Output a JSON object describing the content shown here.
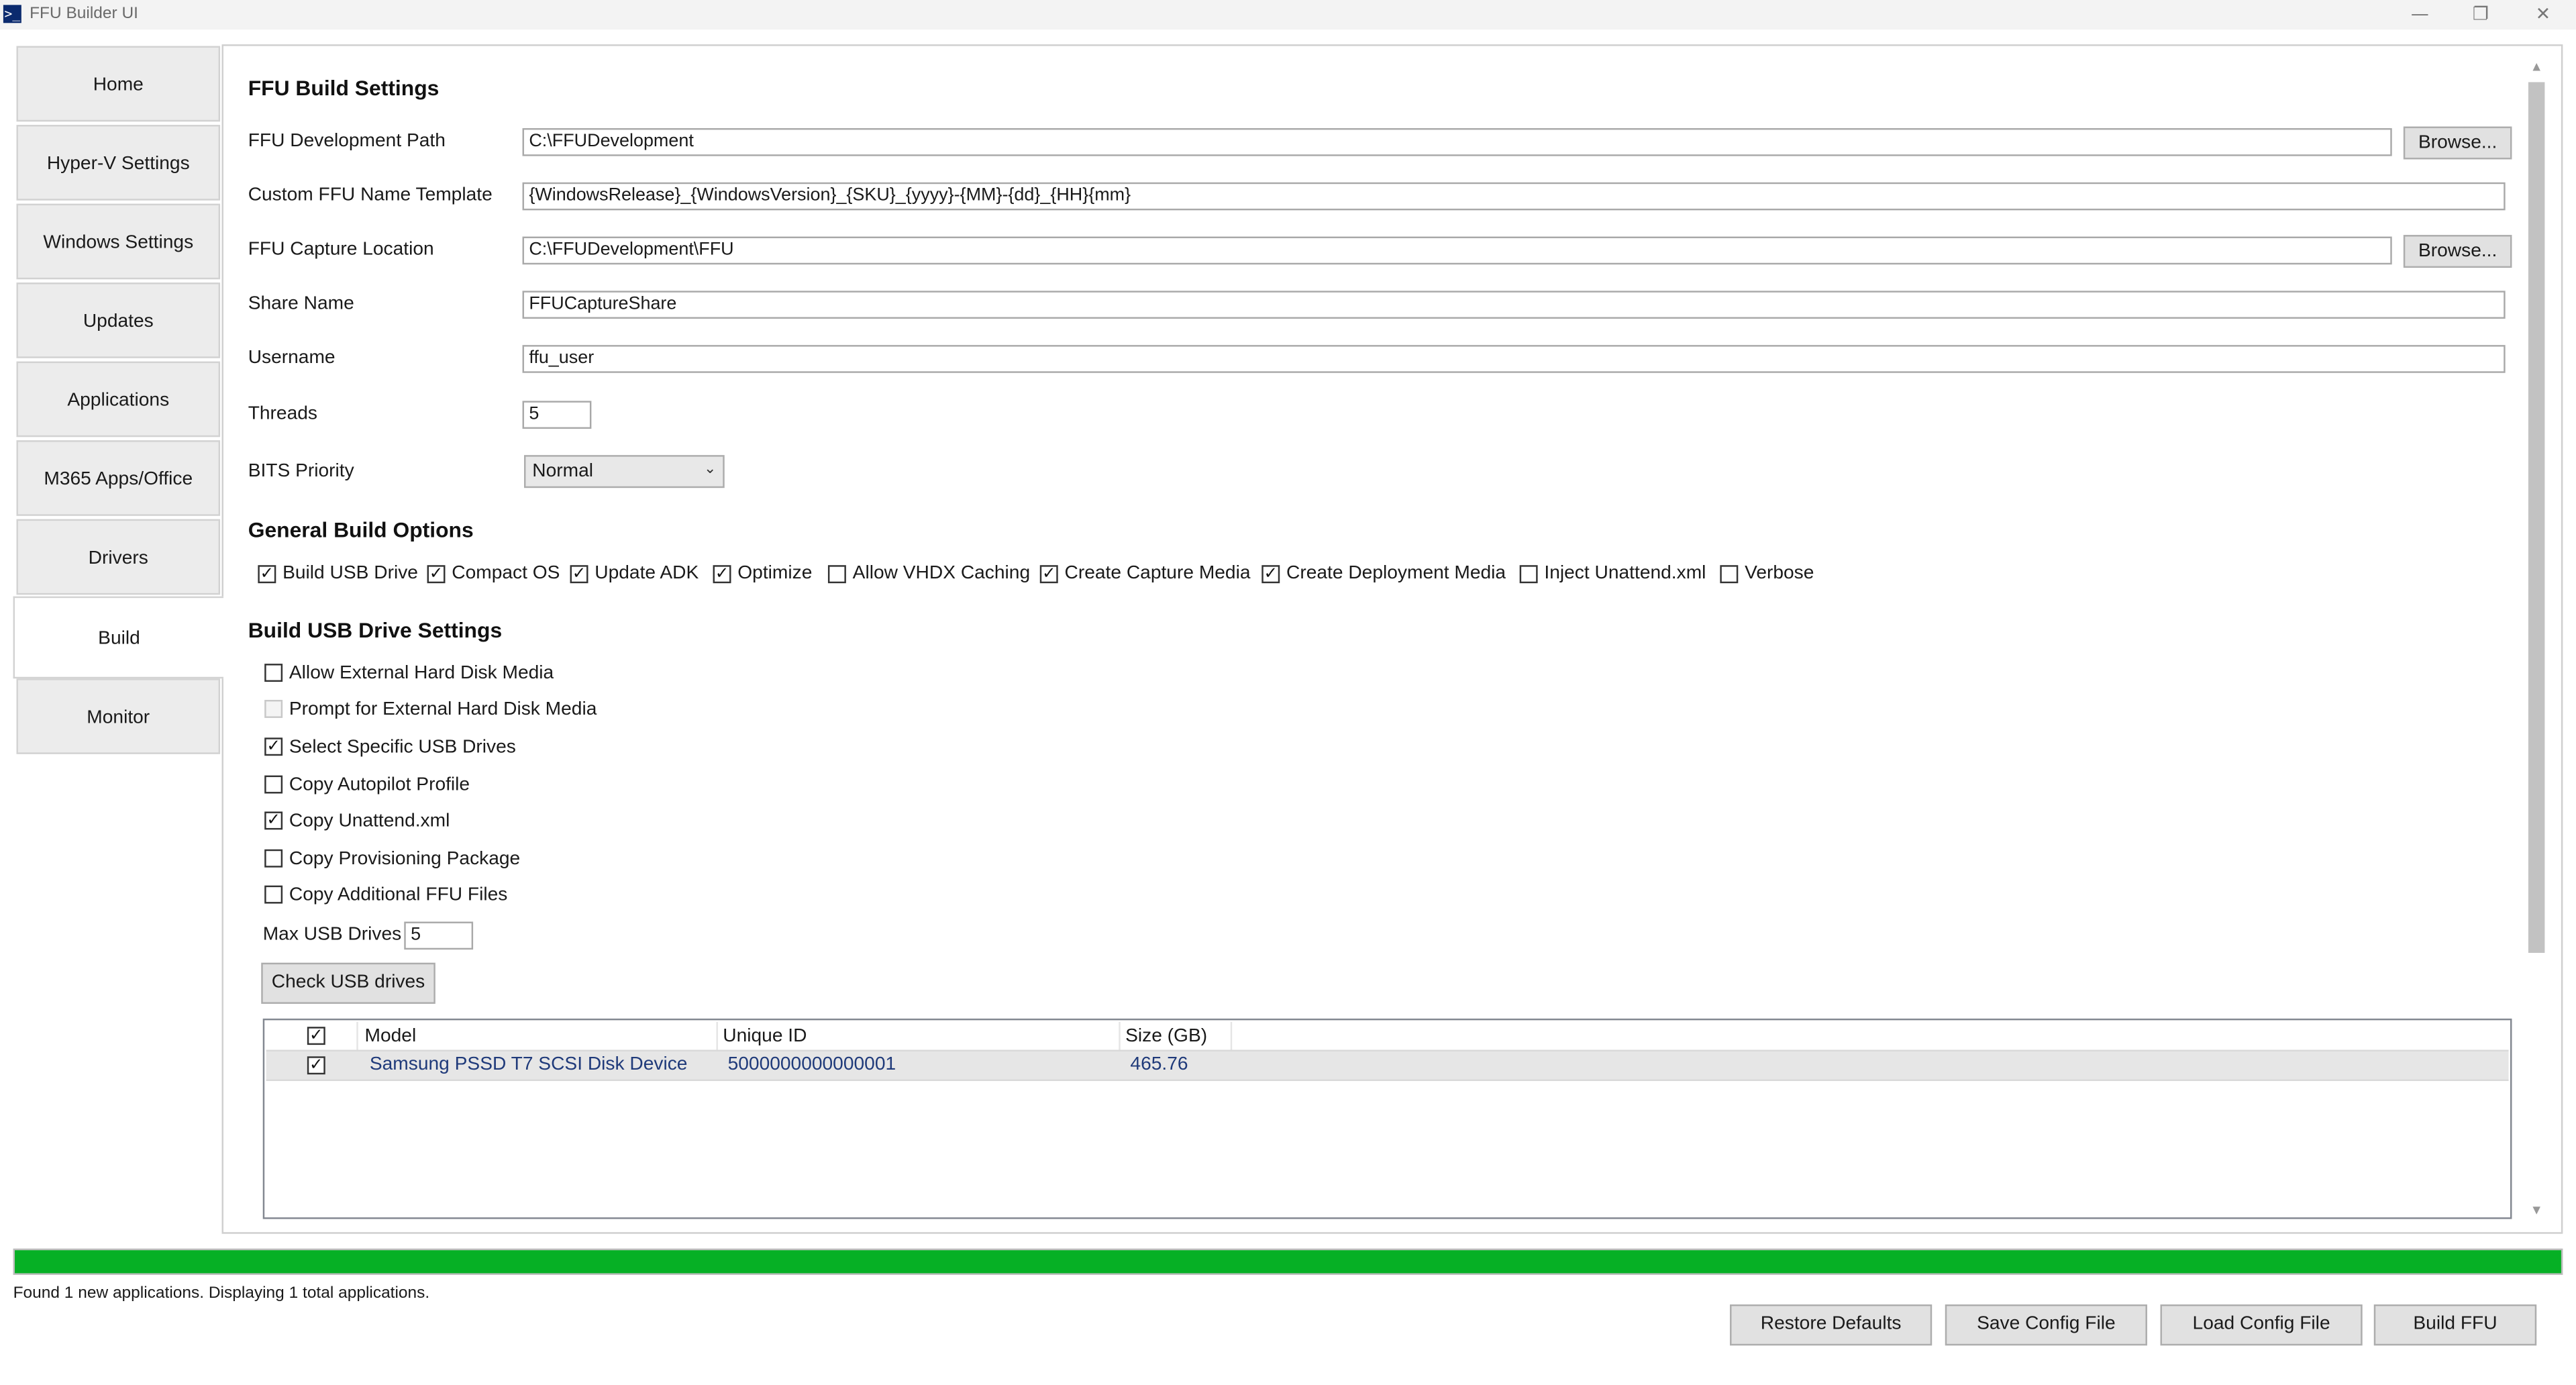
{
  "window": {
    "title": "FFU Builder UI",
    "app_icon": "powershell-icon",
    "controls": {
      "minimize": "—",
      "restore": "❐",
      "close": "✕"
    }
  },
  "tabs": [
    {
      "label": "Home"
    },
    {
      "label": "Hyper-V Settings"
    },
    {
      "label": "Windows Settings"
    },
    {
      "label": "Updates"
    },
    {
      "label": "Applications"
    },
    {
      "label": "M365 Apps/Office"
    },
    {
      "label": "Drivers"
    },
    {
      "label": "Build",
      "active": true
    },
    {
      "label": "Monitor"
    }
  ],
  "build_settings": {
    "heading": "FFU Build Settings",
    "dev_path": {
      "label": "FFU Development Path",
      "value": "C:\\FFUDevelopment",
      "button": "Browse..."
    },
    "name_template": {
      "label": "Custom FFU Name Template",
      "value": "{WindowsRelease}_{WindowsVersion}_{SKU}_{yyyy}-{MM}-{dd}_{HH}{mm}"
    },
    "capture_location": {
      "label": "FFU Capture Location",
      "value": "C:\\FFUDevelopment\\FFU",
      "button": "Browse..."
    },
    "share_name": {
      "label": "Share Name",
      "value": "FFUCaptureShare"
    },
    "username": {
      "label": "Username",
      "value": "ffu_user"
    },
    "threads": {
      "label": "Threads",
      "value": "5"
    },
    "bits_priority": {
      "label": "BITS Priority",
      "value": "Normal"
    }
  },
  "general_options": {
    "heading": "General Build Options",
    "items": [
      {
        "label": "Build USB Drive",
        "checked": true
      },
      {
        "label": "Compact OS",
        "checked": true
      },
      {
        "label": "Update ADK",
        "checked": true
      },
      {
        "label": "Optimize",
        "checked": true
      },
      {
        "label": "Allow VHDX Caching",
        "checked": false
      },
      {
        "label": "Create Capture Media",
        "checked": true
      },
      {
        "label": "Create Deployment Media",
        "checked": true
      },
      {
        "label": "Inject Unattend.xml",
        "checked": false
      },
      {
        "label": "Verbose",
        "checked": false
      }
    ]
  },
  "usb_settings": {
    "heading": "Build USB Drive Settings",
    "items": [
      {
        "label": "Allow External Hard Disk Media",
        "checked": false
      },
      {
        "label": "Prompt for External Hard Disk Media",
        "checked": false,
        "disabled": true
      },
      {
        "label": "Select Specific USB Drives",
        "checked": true
      },
      {
        "label": "Copy Autopilot Profile",
        "checked": false
      },
      {
        "label": "Copy Unattend.xml",
        "checked": true
      },
      {
        "label": "Copy Provisioning Package",
        "checked": false
      },
      {
        "label": "Copy Additional FFU Files",
        "checked": false
      }
    ],
    "max_usb_drives": {
      "label": "Max USB Drives",
      "value": "5"
    },
    "check_button": "Check USB drives",
    "table": {
      "headers": [
        "Model",
        "Unique ID",
        "Size (GB)"
      ],
      "header_checked": true,
      "rows": [
        {
          "checked": true,
          "model": "Samsung PSSD T7 SCSI Disk Device",
          "unique_id": "5000000000000001",
          "size": "465.76"
        }
      ]
    }
  },
  "progress": {
    "value": 1.0,
    "color": "#06b025"
  },
  "status": "Found 1 new applications. Displaying 1 total applications.",
  "footer_buttons": {
    "restore": "Restore Defaults",
    "save": "Save Config File",
    "load": "Load Config File",
    "build": "Build FFU"
  }
}
